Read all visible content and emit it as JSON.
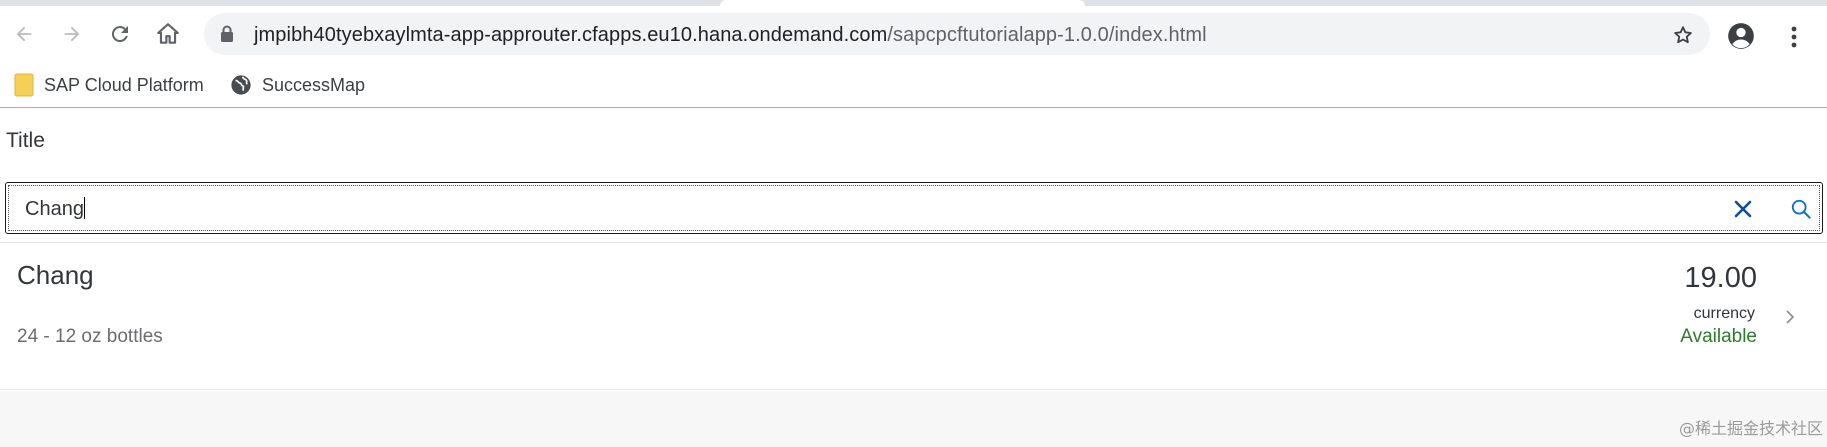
{
  "browser": {
    "url_host": "jmpibh40tyebxaylmta-app-approuter.cfapps.eu10.hana.ondemand.com",
    "url_path": "/sapcpcftutorialapp-1.0.0/index.html",
    "icons": [
      "back-icon",
      "forward-icon",
      "reload-icon",
      "home-icon",
      "lock-icon",
      "star-icon",
      "profile-icon",
      "menu-icon"
    ]
  },
  "bookmarks": [
    {
      "label": "SAP Cloud Platform",
      "icon": "folder-icon"
    },
    {
      "label": "SuccessMap",
      "icon": "globe-icon"
    }
  ],
  "app": {
    "title": "Title",
    "search": {
      "value": "Chang"
    },
    "items": [
      {
        "name": "Chang",
        "description": "24 - 12 oz bottles",
        "price": "19.00",
        "unit": "currency",
        "status": "Available"
      }
    ]
  },
  "watermark": "@稀土掘金技术社区",
  "colors": {
    "status_available": "#2b7c2b",
    "accent": "#0a6ed1"
  }
}
